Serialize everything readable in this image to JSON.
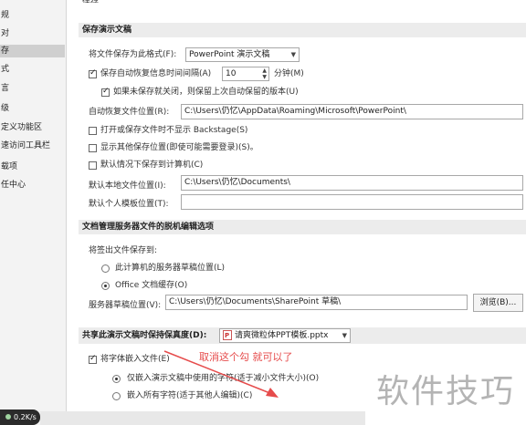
{
  "sidebar": {
    "items": [
      {
        "label": "规"
      },
      {
        "label": "对"
      },
      {
        "label": "存",
        "active": true
      },
      {
        "label": "式"
      },
      {
        "label": "言"
      },
      {
        "label": "级"
      },
      {
        "label": "定义功能区"
      },
      {
        "label": "速访问工具栏"
      },
      {
        "label": "载项"
      },
      {
        "label": "任中心"
      }
    ]
  },
  "top_cut_text": "保存",
  "save_presentations": {
    "header": "保存演示文稿",
    "format_label": "将文件保存为此格式(F):",
    "format_value": "PowerPoint 演示文稿",
    "autorecover_label": "保存自动恢复信息时间间隔(A)",
    "autorecover_value": "10",
    "minutes_label": "分钟(M)",
    "keep_last_label": "如果未保存就关闭，则保留上次自动保留的版本(U)",
    "autorecover_location_label": "自动恢复文件位置(R):",
    "autorecover_location_value": "C:\\Users\\仍忆\\AppData\\Roaming\\Microsoft\\PowerPoint\\",
    "no_backstage_label": "打开或保存文件时不显示 Backstage(S)",
    "show_additional_label": "显示其他保存位置(即使可能需要登录)(S)。",
    "save_to_computer_label": "默认情况下保存到计算机(C)",
    "default_local_label": "默认本地文件位置(I):",
    "default_local_value": "C:\\Users\\仍忆\\Documents\\",
    "personal_templates_label": "默认个人模板位置(T):",
    "personal_templates_value": ""
  },
  "offline": {
    "header": "文档管理服务器文件的脱机编辑选项",
    "save_checked_out_label": "将签出文件保存到:",
    "option_server_drafts": "此计算机的服务器草稿位置(L)",
    "option_office_cache": "Office 文档缓存(O)",
    "server_drafts_label": "服务器草稿位置(V):",
    "server_drafts_value": "C:\\Users\\仍忆\\Documents\\SharePoint 草稿\\",
    "browse_label": "浏览(B)..."
  },
  "fidelity": {
    "header": "共享此演示文稿时保持保真度(D):",
    "file_value": "请爽微粒体PPT模板.pptx",
    "embed_fonts_label": "将字体嵌入文件(E)",
    "embed_only_used": "仅嵌入演示文稿中使用的字符(适于减小文件大小)(O)",
    "embed_all": "嵌入所有字符(适于其他人编辑)(C)"
  },
  "annotation": "取消这个勾 就可以了",
  "watermark": "软件技巧",
  "net_speed": "0.2K/s",
  "colors": {
    "annotation": "#e64b4b",
    "section_bg": "#ececec"
  }
}
